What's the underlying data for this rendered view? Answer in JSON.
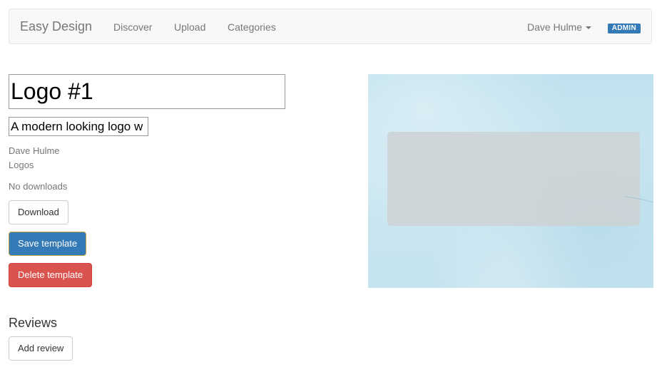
{
  "navbar": {
    "brand": "Easy Design",
    "links": [
      "Discover",
      "Upload",
      "Categories"
    ],
    "user_name": "Dave Hulme",
    "badge": "ADMIN"
  },
  "template": {
    "title_value": "Logo #1",
    "description_value": "A modern looking logo w",
    "author": "Dave Hulme",
    "category": "Logos",
    "downloads": "No downloads"
  },
  "actions": {
    "download_label": "Download",
    "save_label": "Save template",
    "delete_label": "Delete template"
  },
  "reviews": {
    "heading": "Reviews",
    "add_label": "Add review"
  },
  "colors": {
    "primary": "#337ab7",
    "danger": "#d9534f",
    "badge": "#337ab7"
  }
}
